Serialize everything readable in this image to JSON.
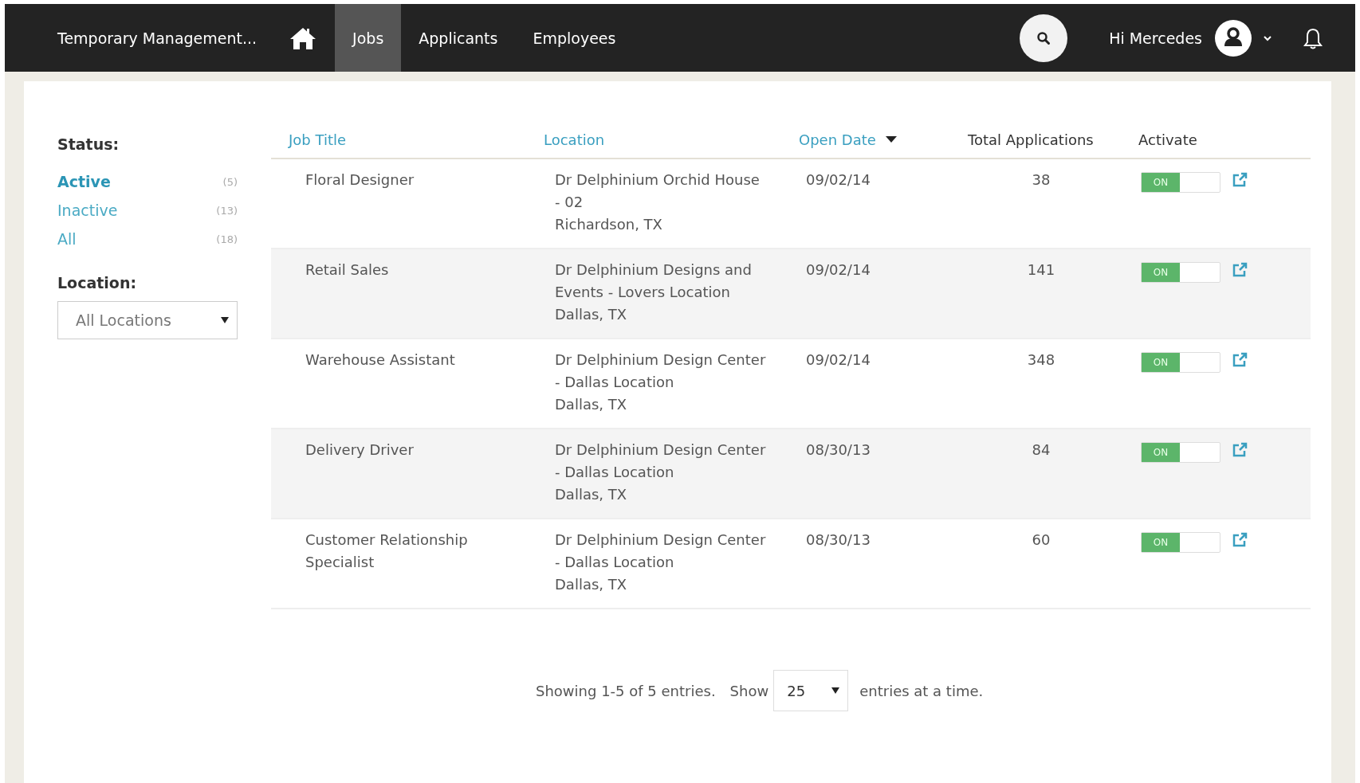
{
  "nav": {
    "brand": "Temporary Management...",
    "items": [
      {
        "label": "Jobs",
        "selected": true
      },
      {
        "label": "Applicants",
        "selected": false
      },
      {
        "label": "Employees",
        "selected": false
      }
    ],
    "greeting": "Hi Mercedes"
  },
  "sidebar": {
    "status_label": "Status:",
    "status_items": [
      {
        "label": "Active",
        "count": "(5)",
        "selected": true
      },
      {
        "label": "Inactive",
        "count": "(13)",
        "selected": false
      },
      {
        "label": "All",
        "count": "(18)",
        "selected": false
      }
    ],
    "location_label": "Location:",
    "location_select": "All Locations"
  },
  "table": {
    "columns": [
      {
        "label": "Job Title",
        "sortable": true,
        "sorted": false
      },
      {
        "label": "Location",
        "sortable": true,
        "sorted": false
      },
      {
        "label": "Open Date",
        "sortable": true,
        "sorted": true
      },
      {
        "label": "Total Applications",
        "sortable": false,
        "sorted": false
      },
      {
        "label": "Activate",
        "sortable": false,
        "sorted": false
      }
    ],
    "rows": [
      {
        "title": "Floral Designer",
        "location": [
          "Dr Delphinium Orchid House",
          "- 02",
          "Richardson, TX"
        ],
        "open_date": "09/02/14",
        "applications": "38",
        "toggle": "ON",
        "on": true
      },
      {
        "title": "Retail Sales",
        "location": [
          "Dr Delphinium Designs and",
          "Events - Lovers Location",
          "Dallas, TX"
        ],
        "open_date": "09/02/14",
        "applications": "141",
        "toggle": "ON",
        "on": true
      },
      {
        "title": "Warehouse Assistant",
        "location": [
          "Dr Delphinium Design Center",
          "- Dallas Location",
          "Dallas, TX"
        ],
        "open_date": "09/02/14",
        "applications": "348",
        "toggle": "ON",
        "on": true
      },
      {
        "title": "Delivery Driver",
        "location": [
          "Dr Delphinium Design Center",
          "- Dallas Location",
          "Dallas, TX"
        ],
        "open_date": "08/30/13",
        "applications": "84",
        "toggle": "ON",
        "on": true
      },
      {
        "title": "Customer Relationship\nSpecialist",
        "location": [
          "Dr Delphinium Design Center",
          "- Dallas Location",
          "Dallas, TX"
        ],
        "open_date": "08/30/13",
        "applications": "60",
        "toggle": "ON",
        "on": true
      }
    ]
  },
  "pagination": {
    "summary": "Showing 1-5 of 5 entries.",
    "show_label": "Show",
    "page_size": "25",
    "suffix": "entries at a time."
  }
}
